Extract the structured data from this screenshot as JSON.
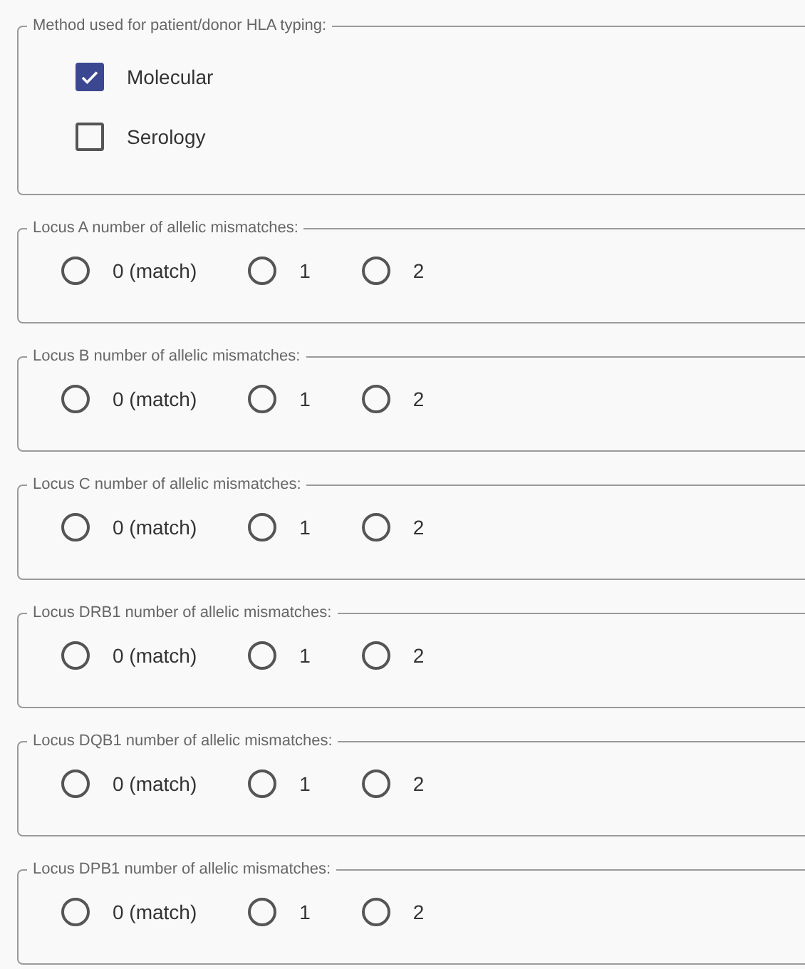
{
  "method": {
    "legend": "Method used for patient/donor HLA typing:",
    "options": [
      {
        "label": "Molecular",
        "checked": true
      },
      {
        "label": "Serology",
        "checked": false
      }
    ]
  },
  "loci": [
    {
      "legend": "Locus A number of allelic mismatches:",
      "options": [
        {
          "label": "0 (match)",
          "selected": false
        },
        {
          "label": "1",
          "selected": false
        },
        {
          "label": "2",
          "selected": false
        }
      ]
    },
    {
      "legend": "Locus B number of allelic mismatches:",
      "options": [
        {
          "label": "0 (match)",
          "selected": false
        },
        {
          "label": "1",
          "selected": false
        },
        {
          "label": "2",
          "selected": false
        }
      ]
    },
    {
      "legend": "Locus C number of allelic mismatches:",
      "options": [
        {
          "label": "0 (match)",
          "selected": false
        },
        {
          "label": "1",
          "selected": false
        },
        {
          "label": "2",
          "selected": false
        }
      ]
    },
    {
      "legend": "Locus DRB1 number of allelic mismatches:",
      "options": [
        {
          "label": "0 (match)",
          "selected": false
        },
        {
          "label": "1",
          "selected": false
        },
        {
          "label": "2",
          "selected": false
        }
      ]
    },
    {
      "legend": "Locus DQB1 number of allelic mismatches:",
      "options": [
        {
          "label": "0 (match)",
          "selected": false
        },
        {
          "label": "1",
          "selected": false
        },
        {
          "label": "2",
          "selected": false
        }
      ]
    },
    {
      "legend": "Locus DPB1 number of allelic mismatches:",
      "options": [
        {
          "label": "0 (match)",
          "selected": false
        },
        {
          "label": "1",
          "selected": false
        },
        {
          "label": "2",
          "selected": false
        }
      ]
    }
  ]
}
